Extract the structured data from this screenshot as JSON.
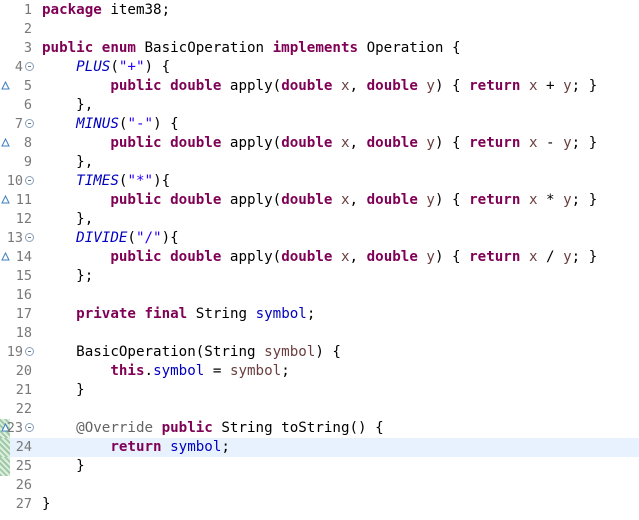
{
  "editor": {
    "current_line": 24,
    "lines": [
      {
        "n": "1",
        "segments": [
          {
            "t": "package",
            "c": "kw"
          },
          {
            "t": " item38;",
            "c": ""
          }
        ]
      },
      {
        "n": "2",
        "segments": []
      },
      {
        "n": "3",
        "segments": [
          {
            "t": "public",
            "c": "kw"
          },
          {
            "t": " ",
            "c": ""
          },
          {
            "t": "enum",
            "c": "kw"
          },
          {
            "t": " BasicOperation ",
            "c": ""
          },
          {
            "t": "implements",
            "c": "kw"
          },
          {
            "t": " Operation {",
            "c": ""
          }
        ]
      },
      {
        "n": "4",
        "fold": true,
        "segments": [
          {
            "t": "    ",
            "c": ""
          },
          {
            "t": "PLUS",
            "c": "constant"
          },
          {
            "t": "(",
            "c": ""
          },
          {
            "t": "\"+\"",
            "c": "str"
          },
          {
            "t": ") {",
            "c": ""
          }
        ]
      },
      {
        "n": "5",
        "override": true,
        "segments": [
          {
            "t": "        ",
            "c": ""
          },
          {
            "t": "public",
            "c": "kw"
          },
          {
            "t": " ",
            "c": ""
          },
          {
            "t": "double",
            "c": "kw"
          },
          {
            "t": " apply(",
            "c": ""
          },
          {
            "t": "double",
            "c": "kw"
          },
          {
            "t": " ",
            "c": ""
          },
          {
            "t": "x",
            "c": "param"
          },
          {
            "t": ", ",
            "c": ""
          },
          {
            "t": "double",
            "c": "kw"
          },
          {
            "t": " ",
            "c": ""
          },
          {
            "t": "y",
            "c": "param"
          },
          {
            "t": ") { ",
            "c": ""
          },
          {
            "t": "return",
            "c": "kw"
          },
          {
            "t": " ",
            "c": ""
          },
          {
            "t": "x",
            "c": "param"
          },
          {
            "t": " + ",
            "c": ""
          },
          {
            "t": "y",
            "c": "param"
          },
          {
            "t": "; }",
            "c": ""
          }
        ]
      },
      {
        "n": "6",
        "segments": [
          {
            "t": "    },",
            "c": ""
          }
        ]
      },
      {
        "n": "7",
        "fold": true,
        "segments": [
          {
            "t": "    ",
            "c": ""
          },
          {
            "t": "MINUS",
            "c": "constant"
          },
          {
            "t": "(",
            "c": ""
          },
          {
            "t": "\"-\"",
            "c": "str"
          },
          {
            "t": ") {",
            "c": ""
          }
        ]
      },
      {
        "n": "8",
        "override": true,
        "segments": [
          {
            "t": "        ",
            "c": ""
          },
          {
            "t": "public",
            "c": "kw"
          },
          {
            "t": " ",
            "c": ""
          },
          {
            "t": "double",
            "c": "kw"
          },
          {
            "t": " apply(",
            "c": ""
          },
          {
            "t": "double",
            "c": "kw"
          },
          {
            "t": " ",
            "c": ""
          },
          {
            "t": "x",
            "c": "param"
          },
          {
            "t": ", ",
            "c": ""
          },
          {
            "t": "double",
            "c": "kw"
          },
          {
            "t": " ",
            "c": ""
          },
          {
            "t": "y",
            "c": "param"
          },
          {
            "t": ") { ",
            "c": ""
          },
          {
            "t": "return",
            "c": "kw"
          },
          {
            "t": " ",
            "c": ""
          },
          {
            "t": "x",
            "c": "param"
          },
          {
            "t": " - ",
            "c": ""
          },
          {
            "t": "y",
            "c": "param"
          },
          {
            "t": "; }",
            "c": ""
          }
        ]
      },
      {
        "n": "9",
        "segments": [
          {
            "t": "    },",
            "c": ""
          }
        ]
      },
      {
        "n": "10",
        "fold": true,
        "segments": [
          {
            "t": "    ",
            "c": ""
          },
          {
            "t": "TIMES",
            "c": "constant"
          },
          {
            "t": "(",
            "c": ""
          },
          {
            "t": "\"*\"",
            "c": "str"
          },
          {
            "t": "){",
            "c": ""
          }
        ]
      },
      {
        "n": "11",
        "override": true,
        "segments": [
          {
            "t": "        ",
            "c": ""
          },
          {
            "t": "public",
            "c": "kw"
          },
          {
            "t": " ",
            "c": ""
          },
          {
            "t": "double",
            "c": "kw"
          },
          {
            "t": " apply(",
            "c": ""
          },
          {
            "t": "double",
            "c": "kw"
          },
          {
            "t": " ",
            "c": ""
          },
          {
            "t": "x",
            "c": "param"
          },
          {
            "t": ", ",
            "c": ""
          },
          {
            "t": "double",
            "c": "kw"
          },
          {
            "t": " ",
            "c": ""
          },
          {
            "t": "y",
            "c": "param"
          },
          {
            "t": ") { ",
            "c": ""
          },
          {
            "t": "return",
            "c": "kw"
          },
          {
            "t": " ",
            "c": ""
          },
          {
            "t": "x",
            "c": "param"
          },
          {
            "t": " * ",
            "c": ""
          },
          {
            "t": "y",
            "c": "param"
          },
          {
            "t": "; }",
            "c": ""
          }
        ]
      },
      {
        "n": "12",
        "segments": [
          {
            "t": "    },",
            "c": ""
          }
        ]
      },
      {
        "n": "13",
        "fold": true,
        "segments": [
          {
            "t": "    ",
            "c": ""
          },
          {
            "t": "DIVIDE",
            "c": "constant"
          },
          {
            "t": "(",
            "c": ""
          },
          {
            "t": "\"/\"",
            "c": "str"
          },
          {
            "t": "){",
            "c": ""
          }
        ]
      },
      {
        "n": "14",
        "override": true,
        "segments": [
          {
            "t": "        ",
            "c": ""
          },
          {
            "t": "public",
            "c": "kw"
          },
          {
            "t": " ",
            "c": ""
          },
          {
            "t": "double",
            "c": "kw"
          },
          {
            "t": " apply(",
            "c": ""
          },
          {
            "t": "double",
            "c": "kw"
          },
          {
            "t": " ",
            "c": ""
          },
          {
            "t": "x",
            "c": "param"
          },
          {
            "t": ", ",
            "c": ""
          },
          {
            "t": "double",
            "c": "kw"
          },
          {
            "t": " ",
            "c": ""
          },
          {
            "t": "y",
            "c": "param"
          },
          {
            "t": ") { ",
            "c": ""
          },
          {
            "t": "return",
            "c": "kw"
          },
          {
            "t": " ",
            "c": ""
          },
          {
            "t": "x",
            "c": "param"
          },
          {
            "t": " / ",
            "c": ""
          },
          {
            "t": "y",
            "c": "param"
          },
          {
            "t": "; }",
            "c": ""
          }
        ]
      },
      {
        "n": "15",
        "segments": [
          {
            "t": "    };",
            "c": ""
          }
        ]
      },
      {
        "n": "16",
        "segments": []
      },
      {
        "n": "17",
        "segments": [
          {
            "t": "    ",
            "c": ""
          },
          {
            "t": "private",
            "c": "kw"
          },
          {
            "t": " ",
            "c": ""
          },
          {
            "t": "final",
            "c": "kw"
          },
          {
            "t": " String ",
            "c": ""
          },
          {
            "t": "symbol",
            "c": "field"
          },
          {
            "t": ";",
            "c": ""
          }
        ]
      },
      {
        "n": "18",
        "segments": []
      },
      {
        "n": "19",
        "fold": true,
        "segments": [
          {
            "t": "    BasicOperation(String ",
            "c": ""
          },
          {
            "t": "symbol",
            "c": "param"
          },
          {
            "t": ") {",
            "c": ""
          }
        ]
      },
      {
        "n": "20",
        "segments": [
          {
            "t": "        ",
            "c": ""
          },
          {
            "t": "this",
            "c": "kw"
          },
          {
            "t": ".",
            "c": ""
          },
          {
            "t": "symbol",
            "c": "field"
          },
          {
            "t": " = ",
            "c": ""
          },
          {
            "t": "symbol",
            "c": "param"
          },
          {
            "t": ";",
            "c": ""
          }
        ]
      },
      {
        "n": "21",
        "segments": [
          {
            "t": "    }",
            "c": ""
          }
        ]
      },
      {
        "n": "22",
        "segments": []
      },
      {
        "n": "23",
        "fold": true,
        "override": true,
        "bookmark": true,
        "segments": [
          {
            "t": "    ",
            "c": ""
          },
          {
            "t": "@Override",
            "c": "ann"
          },
          {
            "t": " ",
            "c": ""
          },
          {
            "t": "public",
            "c": "kw"
          },
          {
            "t": " String toString() {",
            "c": ""
          }
        ]
      },
      {
        "n": "24",
        "bookmark": true,
        "segments": [
          {
            "t": "        ",
            "c": ""
          },
          {
            "t": "return",
            "c": "kw"
          },
          {
            "t": " ",
            "c": ""
          },
          {
            "t": "symbol",
            "c": "field"
          },
          {
            "t": ";",
            "c": ""
          }
        ]
      },
      {
        "n": "25",
        "bookmark": true,
        "segments": [
          {
            "t": "    }",
            "c": ""
          }
        ]
      },
      {
        "n": "26",
        "segments": []
      },
      {
        "n": "27",
        "segments": [
          {
            "t": "}",
            "c": ""
          }
        ]
      }
    ]
  }
}
